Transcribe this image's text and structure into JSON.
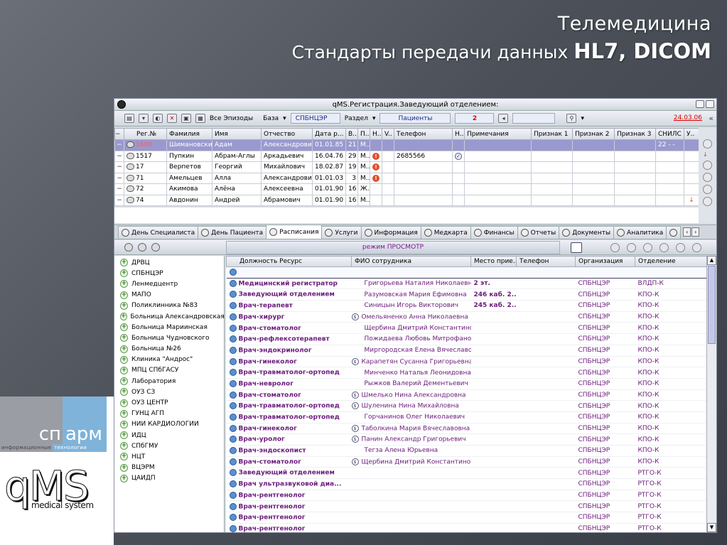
{
  "slide": {
    "title_line1": "Телемедицина",
    "title_line2": "Стандарты передачи данных ",
    "title_line2_bold": "HL7, DICOM"
  },
  "logos": {
    "sn": "сп",
    "arm": "арм",
    "sub_left": "информационные",
    "sub_right": "технологии",
    "qms": "qMS",
    "qms_sub": "medical system"
  },
  "window": {
    "title": "qMS.Регистрация.Заведующий отделением:"
  },
  "toolbar": {
    "all_episodes": "Все Эпизоды",
    "base_label": "База",
    "base_value": "СПБНЦЭР",
    "section_label": "Раздел",
    "section_value": "Пациенты",
    "count": "2",
    "date": "24.03.06"
  },
  "patients": {
    "columns": [
      "Рег.№",
      "Фамилия",
      "Имя",
      "Отчество",
      "Дата р...",
      "В..",
      "П..",
      "Н..",
      "V..",
      "Телефон",
      "Н..",
      "Примечания",
      "Признак 1",
      "Признак 2",
      "Признак 3",
      "СНИЛС",
      "У.."
    ],
    "rows": [
      {
        "reg": "1600",
        "last": "Шимановский",
        "first": "Адам",
        "middle": "Александрович",
        "dob": "01.01.85",
        "age": "21",
        "sex": "М..",
        "warn": "",
        "phone": "",
        "check": "",
        "snils": "22 - -"
      },
      {
        "reg": "1517",
        "last": "Пупкин",
        "first": "Абрам-Аглы",
        "middle": "Аркадьевич",
        "dob": "16.04.76",
        "age": "29",
        "sex": "М..",
        "warn": "!",
        "phone": "2685566",
        "check": "✓",
        "snils": ""
      },
      {
        "reg": "17",
        "last": "Верпетов",
        "first": "Георгий",
        "middle": "Михайлович",
        "dob": "18.02.87",
        "age": "19",
        "sex": "М..",
        "warn": "!",
        "phone": "",
        "check": "",
        "snils": ""
      },
      {
        "reg": "71",
        "last": "Амельцев",
        "first": "Алла",
        "middle": "Александрович",
        "dob": "01.01.03",
        "age": "3",
        "sex": "М..",
        "warn": "!",
        "phone": "",
        "check": "",
        "snils": ""
      },
      {
        "reg": "72",
        "last": "Акимова",
        "first": "Алёна",
        "middle": "Алексеевна",
        "dob": "01.01.90",
        "age": "16",
        "sex": "Ж..",
        "warn": "",
        "phone": "",
        "check": "",
        "snils": ""
      },
      {
        "reg": "74",
        "last": "Авдонин",
        "first": "Андрей",
        "middle": "Абрамович",
        "dob": "01.01.90",
        "age": "16",
        "sex": "М..",
        "warn": "",
        "phone": "",
        "check": "",
        "snils": ""
      }
    ]
  },
  "tabs": [
    "День Специалиста",
    "День Пациента",
    "Расписания",
    "Услуги",
    "Информация",
    "Медкарта",
    "Финансы",
    "Отчеты",
    "Документы",
    "Аналитика"
  ],
  "mode_text": "режим ПРОСМОТР",
  "tree": [
    "ДРВЦ",
    "СПБНЦЭР",
    "Ленмедцентр",
    "МАПО",
    "Поликлинника №83",
    "Больница Александровская",
    "Больница Мариинская",
    "Больница Чудновского",
    "Больница №26",
    "Клиника \"Андрос\"",
    "МПЦ СПбГАСУ",
    "Лаборатория",
    "ОУЗ СЗ",
    "ОУЗ ЦЕНТР",
    "ГУНЦ АГП",
    "НИИ КАРДИОЛОГИИ",
    "ИДЦ",
    "СПбГМУ",
    "НЦТ",
    "ВЦЭРМ",
    "ЦАИДП"
  ],
  "schedule": {
    "columns": [
      "Должность Ресурс",
      "ФИО сотрудника",
      "Место прие...",
      "Телефон",
      "Организация",
      "Отделение"
    ],
    "rows": [
      {
        "pos": "Медицинский регистратор",
        "emp": "Григорьева Наталия Николаевна",
        "place": "2 эт.",
        "org": "СПБНЦЭР",
        "dep": "ВЛДП-К",
        "d": false
      },
      {
        "pos": "Заведующий отделением",
        "emp": "Разумовская Мария Ефимовна",
        "place": "246 каб. 2...",
        "org": "СПБНЦЭР",
        "dep": "КПО-К",
        "d": false
      },
      {
        "pos": "Врач-терапевт",
        "emp": "Синицын Игорь Викторович",
        "place": "245 каб. 2...",
        "org": "СПБНЦЭР",
        "dep": "КПО-К",
        "d": false
      },
      {
        "pos": "Врач-хирург",
        "emp": "Омельяненко Анна Николаевна",
        "place": "",
        "org": "СПБНЦЭР",
        "dep": "КПО-К",
        "d": true
      },
      {
        "pos": "Врач-стоматолог",
        "emp": "Щербина Дмитрий Константино...",
        "place": "",
        "org": "СПБНЦЭР",
        "dep": "КПО-К",
        "d": false
      },
      {
        "pos": "Врач-рефлексотерапевт",
        "emp": "Пожидаева Любовь Митрофано...",
        "place": "",
        "org": "СПБНЦЭР",
        "dep": "КПО-К",
        "d": false
      },
      {
        "pos": "Врач-эндокринолог",
        "emp": "Миргородская Елена Вячеславо...",
        "place": "",
        "org": "СПБНЦЭР",
        "dep": "КПО-К",
        "d": false
      },
      {
        "pos": "Врач-гинеколог",
        "emp": "Карапетян Сусанна Григорьевна",
        "place": "",
        "org": "СПБНЦЭР",
        "dep": "КПО-К",
        "d": true
      },
      {
        "pos": "Врач-травматолог-ортопед",
        "emp": "Минченко Наталья Леонидовна",
        "place": "",
        "org": "СПБНЦЭР",
        "dep": "КПО-К",
        "d": false
      },
      {
        "pos": "Врач-невролог",
        "emp": "Рыжков Валерий Дементьевич",
        "place": "",
        "org": "СПБНЦЭР",
        "dep": "КПО-К",
        "d": false
      },
      {
        "pos": "Врач-стоматолог",
        "emp": "Шмелько Нина Александровна",
        "place": "",
        "org": "СПБНЦЭР",
        "dep": "КПО-К",
        "d": true
      },
      {
        "pos": "Врач-травматолог-ортопед",
        "emp": "Шуленина Нина Михайловна",
        "place": "",
        "org": "СПБНЦЭР",
        "dep": "КПО-К",
        "d": true
      },
      {
        "pos": "Врач-травматолог-ортопед",
        "emp": "Горчанинов Олег Николаевич",
        "place": "",
        "org": "СПБНЦЭР",
        "dep": "КПО-К",
        "d": false
      },
      {
        "pos": "Врач-гинеколог",
        "emp": "Таболкина Мария Вячеславовна",
        "place": "",
        "org": "СПБНЦЭР",
        "dep": "КПО-К",
        "d": true
      },
      {
        "pos": "Врач-уролог",
        "emp": "Панин Александр Григорьевич",
        "place": "",
        "org": "СПБНЦЭР",
        "dep": "КПО-К",
        "d": true
      },
      {
        "pos": "Врач-эндоскопист",
        "emp": "Тегза Алена Юрьевна",
        "place": "",
        "org": "СПБНЦЭР",
        "dep": "КПО-К",
        "d": false
      },
      {
        "pos": "Врач-стоматолог",
        "emp": "Щербина Дмитрий Константино...",
        "place": "",
        "org": "СПБНЦЭР",
        "dep": "КПО-К",
        "d": true
      },
      {
        "pos": "Заведующий отделением",
        "emp": "",
        "place": "",
        "org": "СПБНЦЭР",
        "dep": "РТГО-К",
        "d": false
      },
      {
        "pos": "Врач ультразвуковой диа...",
        "emp": "",
        "place": "",
        "org": "СПБНЦЭР",
        "dep": "РТГО-К",
        "d": false
      },
      {
        "pos": "Врач-рентгенолог",
        "emp": "",
        "place": "",
        "org": "СПБНЦЭР",
        "dep": "РТГО-К",
        "d": false
      },
      {
        "pos": "Врач-рентгенолог",
        "emp": "",
        "place": "",
        "org": "СПБНЦЭР",
        "dep": "РТГО-К",
        "d": false
      },
      {
        "pos": "Врач-рентгенолог",
        "emp": "",
        "place": "",
        "org": "СПБНЦЭР",
        "dep": "РТГО-К",
        "d": false
      },
      {
        "pos": "Врач-рентгенолог",
        "emp": "",
        "place": "",
        "org": "СПБНЦЭР",
        "dep": "РТГО-К",
        "d": false
      }
    ]
  }
}
